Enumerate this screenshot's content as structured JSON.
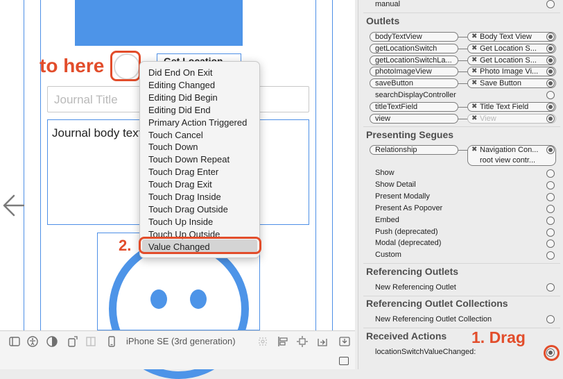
{
  "canvas": {
    "location_label": "Get Location",
    "title_placeholder": "Journal Title",
    "body_text": "Journal body text"
  },
  "annotations": {
    "to_here": "to here",
    "step2": "2.",
    "step1": "1. Drag"
  },
  "popup_menu": {
    "items": [
      "Did End On Exit",
      "Editing Changed",
      "Editing Did Begin",
      "Editing Did End",
      "Primary Action Triggered",
      "Touch Cancel",
      "Touch Down",
      "Touch Down Repeat",
      "Touch Drag Enter",
      "Touch Drag Exit",
      "Touch Drag Inside",
      "Touch Drag Outside",
      "Touch Up Inside",
      "Touch Up Outside",
      "Value Changed"
    ],
    "selected": "Value Changed"
  },
  "toolbar": {
    "device": "iPhone SE (3rd generation)"
  },
  "inspector": {
    "top_row": "manual",
    "outlets_title": "Outlets",
    "outlets": [
      {
        "name": "bodyTextView",
        "target": "Body Text View",
        "connected": true
      },
      {
        "name": "getLocationSwitch",
        "target": "Get Location S...",
        "connected": true
      },
      {
        "name": "getLocationSwitchLa...",
        "target": "Get Location S...",
        "connected": true
      },
      {
        "name": "photoImageView",
        "target": "Photo Image Vi...",
        "connected": true
      },
      {
        "name": "saveButton",
        "target": "Save Button",
        "connected": true
      },
      {
        "name": "searchDisplayController",
        "target": "",
        "connected": false
      },
      {
        "name": "titleTextField",
        "target": "Title Text Field",
        "connected": true
      },
      {
        "name": "view",
        "target": "View",
        "connected": true
      }
    ],
    "segues_title": "Presenting Segues",
    "relationship": {
      "name": "Relationship",
      "target_line1": "Navigation Con...",
      "target_line2": "root view contr..."
    },
    "segues": [
      "Show",
      "Show Detail",
      "Present Modally",
      "Present As Popover",
      "Embed",
      "Push (deprecated)",
      "Modal (deprecated)",
      "Custom"
    ],
    "ref_outlets_title": "Referencing Outlets",
    "new_ref_outlet": "New Referencing Outlet",
    "ref_collections_title": "Referencing Outlet Collections",
    "new_ref_collection": "New Referencing Outlet Collection",
    "received_title": "Received Actions",
    "received_action": "locationSwitchValueChanged:"
  },
  "colors": {
    "accent_blue": "#4d94e8",
    "annotation_red": "#e24d2b"
  }
}
